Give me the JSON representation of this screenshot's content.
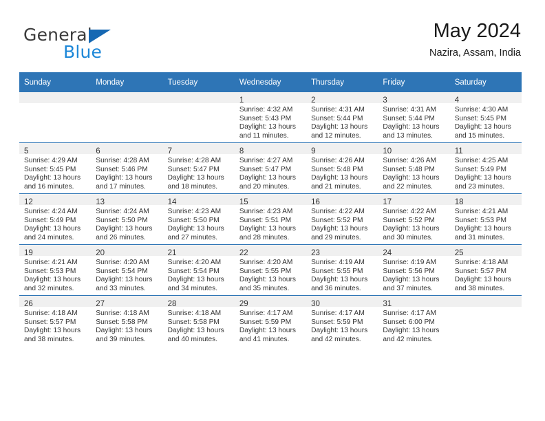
{
  "brand": {
    "name_top": "General",
    "name_bottom": "Blue",
    "triangle_color": "#1668b3",
    "blue_color": "#1c87d8"
  },
  "header": {
    "month_title": "May 2024",
    "location": "Nazira, Assam, India"
  },
  "theme": {
    "header_blue": "#2e75b6",
    "daynum_band": "#f0f0f0",
    "text": "#333333"
  },
  "weekday_headers": [
    "Sunday",
    "Monday",
    "Tuesday",
    "Wednesday",
    "Thursday",
    "Friday",
    "Saturday"
  ],
  "labels": {
    "sunrise_prefix": "Sunrise:",
    "sunset_prefix": "Sunset:",
    "daylight_prefix": "Daylight:"
  },
  "weeks": [
    [
      {
        "day": "",
        "sunrise": "",
        "sunset": "",
        "daylight_line1": "",
        "daylight_line2": ""
      },
      {
        "day": "",
        "sunrise": "",
        "sunset": "",
        "daylight_line1": "",
        "daylight_line2": ""
      },
      {
        "day": "",
        "sunrise": "",
        "sunset": "",
        "daylight_line1": "",
        "daylight_line2": ""
      },
      {
        "day": "1",
        "sunrise": "Sunrise: 4:32 AM",
        "sunset": "Sunset: 5:43 PM",
        "daylight_line1": "Daylight: 13 hours",
        "daylight_line2": "and 11 minutes."
      },
      {
        "day": "2",
        "sunrise": "Sunrise: 4:31 AM",
        "sunset": "Sunset: 5:44 PM",
        "daylight_line1": "Daylight: 13 hours",
        "daylight_line2": "and 12 minutes."
      },
      {
        "day": "3",
        "sunrise": "Sunrise: 4:31 AM",
        "sunset": "Sunset: 5:44 PM",
        "daylight_line1": "Daylight: 13 hours",
        "daylight_line2": "and 13 minutes."
      },
      {
        "day": "4",
        "sunrise": "Sunrise: 4:30 AM",
        "sunset": "Sunset: 5:45 PM",
        "daylight_line1": "Daylight: 13 hours",
        "daylight_line2": "and 15 minutes."
      }
    ],
    [
      {
        "day": "5",
        "sunrise": "Sunrise: 4:29 AM",
        "sunset": "Sunset: 5:45 PM",
        "daylight_line1": "Daylight: 13 hours",
        "daylight_line2": "and 16 minutes."
      },
      {
        "day": "6",
        "sunrise": "Sunrise: 4:28 AM",
        "sunset": "Sunset: 5:46 PM",
        "daylight_line1": "Daylight: 13 hours",
        "daylight_line2": "and 17 minutes."
      },
      {
        "day": "7",
        "sunrise": "Sunrise: 4:28 AM",
        "sunset": "Sunset: 5:47 PM",
        "daylight_line1": "Daylight: 13 hours",
        "daylight_line2": "and 18 minutes."
      },
      {
        "day": "8",
        "sunrise": "Sunrise: 4:27 AM",
        "sunset": "Sunset: 5:47 PM",
        "daylight_line1": "Daylight: 13 hours",
        "daylight_line2": "and 20 minutes."
      },
      {
        "day": "9",
        "sunrise": "Sunrise: 4:26 AM",
        "sunset": "Sunset: 5:48 PM",
        "daylight_line1": "Daylight: 13 hours",
        "daylight_line2": "and 21 minutes."
      },
      {
        "day": "10",
        "sunrise": "Sunrise: 4:26 AM",
        "sunset": "Sunset: 5:48 PM",
        "daylight_line1": "Daylight: 13 hours",
        "daylight_line2": "and 22 minutes."
      },
      {
        "day": "11",
        "sunrise": "Sunrise: 4:25 AM",
        "sunset": "Sunset: 5:49 PM",
        "daylight_line1": "Daylight: 13 hours",
        "daylight_line2": "and 23 minutes."
      }
    ],
    [
      {
        "day": "12",
        "sunrise": "Sunrise: 4:24 AM",
        "sunset": "Sunset: 5:49 PM",
        "daylight_line1": "Daylight: 13 hours",
        "daylight_line2": "and 24 minutes."
      },
      {
        "day": "13",
        "sunrise": "Sunrise: 4:24 AM",
        "sunset": "Sunset: 5:50 PM",
        "daylight_line1": "Daylight: 13 hours",
        "daylight_line2": "and 26 minutes."
      },
      {
        "day": "14",
        "sunrise": "Sunrise: 4:23 AM",
        "sunset": "Sunset: 5:50 PM",
        "daylight_line1": "Daylight: 13 hours",
        "daylight_line2": "and 27 minutes."
      },
      {
        "day": "15",
        "sunrise": "Sunrise: 4:23 AM",
        "sunset": "Sunset: 5:51 PM",
        "daylight_line1": "Daylight: 13 hours",
        "daylight_line2": "and 28 minutes."
      },
      {
        "day": "16",
        "sunrise": "Sunrise: 4:22 AM",
        "sunset": "Sunset: 5:52 PM",
        "daylight_line1": "Daylight: 13 hours",
        "daylight_line2": "and 29 minutes."
      },
      {
        "day": "17",
        "sunrise": "Sunrise: 4:22 AM",
        "sunset": "Sunset: 5:52 PM",
        "daylight_line1": "Daylight: 13 hours",
        "daylight_line2": "and 30 minutes."
      },
      {
        "day": "18",
        "sunrise": "Sunrise: 4:21 AM",
        "sunset": "Sunset: 5:53 PM",
        "daylight_line1": "Daylight: 13 hours",
        "daylight_line2": "and 31 minutes."
      }
    ],
    [
      {
        "day": "19",
        "sunrise": "Sunrise: 4:21 AM",
        "sunset": "Sunset: 5:53 PM",
        "daylight_line1": "Daylight: 13 hours",
        "daylight_line2": "and 32 minutes."
      },
      {
        "day": "20",
        "sunrise": "Sunrise: 4:20 AM",
        "sunset": "Sunset: 5:54 PM",
        "daylight_line1": "Daylight: 13 hours",
        "daylight_line2": "and 33 minutes."
      },
      {
        "day": "21",
        "sunrise": "Sunrise: 4:20 AM",
        "sunset": "Sunset: 5:54 PM",
        "daylight_line1": "Daylight: 13 hours",
        "daylight_line2": "and 34 minutes."
      },
      {
        "day": "22",
        "sunrise": "Sunrise: 4:20 AM",
        "sunset": "Sunset: 5:55 PM",
        "daylight_line1": "Daylight: 13 hours",
        "daylight_line2": "and 35 minutes."
      },
      {
        "day": "23",
        "sunrise": "Sunrise: 4:19 AM",
        "sunset": "Sunset: 5:55 PM",
        "daylight_line1": "Daylight: 13 hours",
        "daylight_line2": "and 36 minutes."
      },
      {
        "day": "24",
        "sunrise": "Sunrise: 4:19 AM",
        "sunset": "Sunset: 5:56 PM",
        "daylight_line1": "Daylight: 13 hours",
        "daylight_line2": "and 37 minutes."
      },
      {
        "day": "25",
        "sunrise": "Sunrise: 4:18 AM",
        "sunset": "Sunset: 5:57 PM",
        "daylight_line1": "Daylight: 13 hours",
        "daylight_line2": "and 38 minutes."
      }
    ],
    [
      {
        "day": "26",
        "sunrise": "Sunrise: 4:18 AM",
        "sunset": "Sunset: 5:57 PM",
        "daylight_line1": "Daylight: 13 hours",
        "daylight_line2": "and 38 minutes."
      },
      {
        "day": "27",
        "sunrise": "Sunrise: 4:18 AM",
        "sunset": "Sunset: 5:58 PM",
        "daylight_line1": "Daylight: 13 hours",
        "daylight_line2": "and 39 minutes."
      },
      {
        "day": "28",
        "sunrise": "Sunrise: 4:18 AM",
        "sunset": "Sunset: 5:58 PM",
        "daylight_line1": "Daylight: 13 hours",
        "daylight_line2": "and 40 minutes."
      },
      {
        "day": "29",
        "sunrise": "Sunrise: 4:17 AM",
        "sunset": "Sunset: 5:59 PM",
        "daylight_line1": "Daylight: 13 hours",
        "daylight_line2": "and 41 minutes."
      },
      {
        "day": "30",
        "sunrise": "Sunrise: 4:17 AM",
        "sunset": "Sunset: 5:59 PM",
        "daylight_line1": "Daylight: 13 hours",
        "daylight_line2": "and 42 minutes."
      },
      {
        "day": "31",
        "sunrise": "Sunrise: 4:17 AM",
        "sunset": "Sunset: 6:00 PM",
        "daylight_line1": "Daylight: 13 hours",
        "daylight_line2": "and 42 minutes."
      },
      {
        "day": "",
        "sunrise": "",
        "sunset": "",
        "daylight_line1": "",
        "daylight_line2": ""
      }
    ]
  ]
}
